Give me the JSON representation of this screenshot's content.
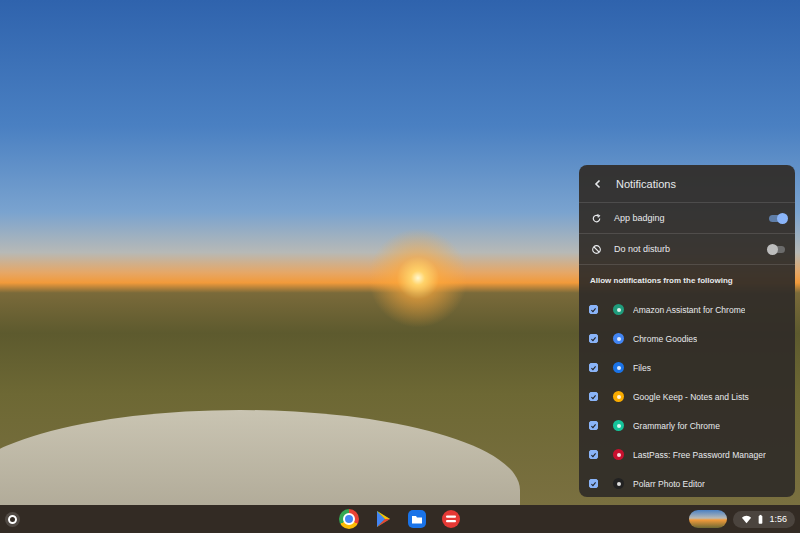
{
  "panel": {
    "title": "Notifications",
    "toggles": [
      {
        "label": "App badging",
        "on": true,
        "kind": "badging"
      },
      {
        "label": "Do not disturb",
        "on": false,
        "kind": "dnd"
      }
    ],
    "section_label": "Allow notifications from the following",
    "apps": [
      {
        "name": "Amazon Assistant for Chrome",
        "checked": true,
        "color": "#1f9c7c"
      },
      {
        "name": "Chrome Goodies",
        "checked": true,
        "color": "#4285f4"
      },
      {
        "name": "Files",
        "checked": true,
        "color": "#1a73e8"
      },
      {
        "name": "Google Keep - Notes and Lists",
        "checked": true,
        "color": "#f9ab00"
      },
      {
        "name": "Grammarly for Chrome",
        "checked": true,
        "color": "#15c39a"
      },
      {
        "name": "LastPass: Free Password Manager",
        "checked": true,
        "color": "#c8102e"
      },
      {
        "name": "Polarr Photo Editor",
        "checked": true,
        "color": "#222222"
      }
    ]
  },
  "status": {
    "time": "1:56"
  }
}
